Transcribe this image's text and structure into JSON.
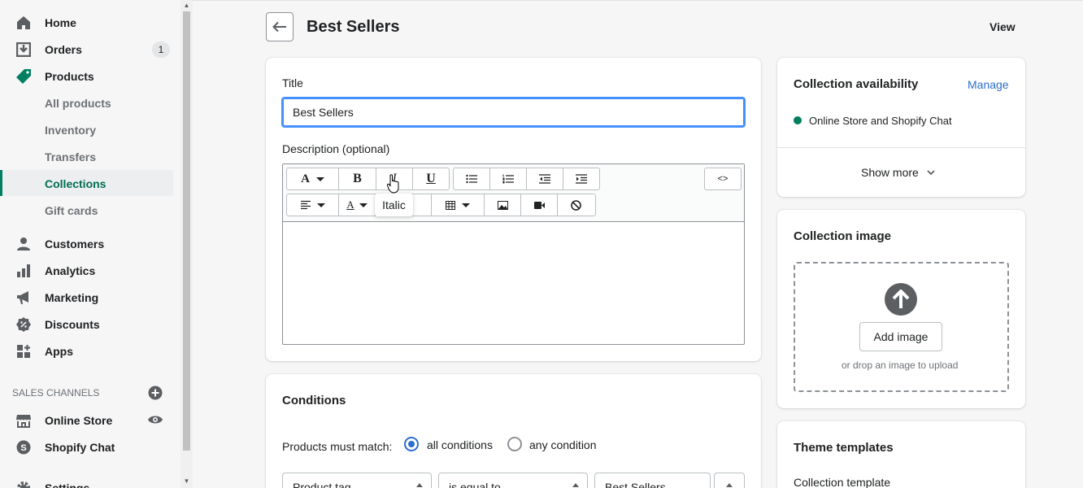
{
  "sidebar": {
    "items": [
      {
        "label": "Home",
        "icon": "home-icon"
      },
      {
        "label": "Orders",
        "icon": "orders-icon",
        "badge": "1"
      },
      {
        "label": "Products",
        "icon": "tag-icon"
      },
      {
        "label": "All products"
      },
      {
        "label": "Inventory"
      },
      {
        "label": "Transfers"
      },
      {
        "label": "Collections"
      },
      {
        "label": "Gift cards"
      },
      {
        "label": "Customers",
        "icon": "person-icon"
      },
      {
        "label": "Analytics",
        "icon": "bar-chart-icon"
      },
      {
        "label": "Marketing",
        "icon": "megaphone-icon"
      },
      {
        "label": "Discounts",
        "icon": "discount-icon"
      },
      {
        "label": "Apps",
        "icon": "apps-icon"
      }
    ],
    "sales_channels_heading": "SALES CHANNELS",
    "channels": [
      {
        "label": "Online Store",
        "icon": "store-icon"
      },
      {
        "label": "Shopify Chat",
        "icon": "chat-icon"
      }
    ],
    "settings_label": "Settings"
  },
  "header": {
    "title": "Best Sellers",
    "view_label": "View"
  },
  "form": {
    "title_label": "Title",
    "title_value": "Best Sellers",
    "description_label": "Description (optional)",
    "code_label": "<>",
    "tooltip": "Italic"
  },
  "conditions": {
    "title": "Conditions",
    "match_label": "Products must match:",
    "all_label": "all conditions",
    "any_label": "any condition",
    "field": "Product tag",
    "operator": "is equal to",
    "value": "Best Sellers"
  },
  "availability": {
    "title": "Collection availability",
    "manage_label": "Manage",
    "channel": "Online Store and Shopify Chat",
    "show_more": "Show more"
  },
  "image": {
    "title": "Collection image",
    "add_label": "Add image",
    "hint": "or drop an image to upload"
  },
  "templates": {
    "title": "Theme templates",
    "label": "Collection template"
  }
}
